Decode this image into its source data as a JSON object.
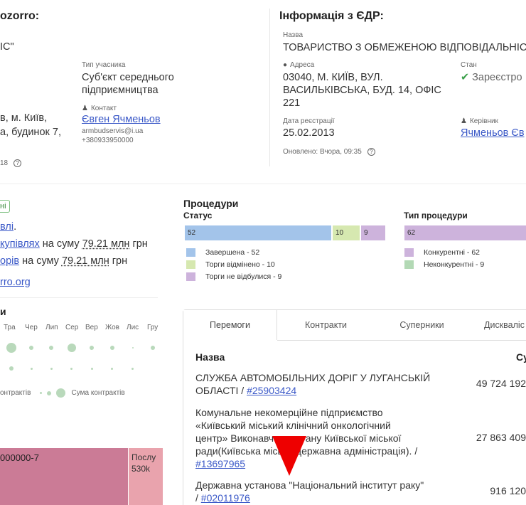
{
  "left_header": {
    "title": "ozorro:",
    "frag1": "ІС\"",
    "participant_type_label": "Тип учасника",
    "participant_type_line1": "Суб'єкт середнього",
    "participant_type_line2": "підприємництва",
    "address_frag1": "в, м. Київ,",
    "address_frag2": "а, будинок 7,",
    "contact_label": "Контакт",
    "contact_name": "Євген Ячменьов",
    "contact_email": "armbudservis@i.ua",
    "contact_phone": "+380933950000",
    "updated_frag": "18"
  },
  "edr": {
    "title": "Інформація з ЄДР:",
    "name_label": "Назва",
    "name_value": "ТОВАРИСТВО З ОБМЕЖЕНОЮ ВІДПОВІДАЛЬНІС",
    "address_label": "Адреса",
    "address_line1": "03040, М. КИЇВ, ВУЛ.",
    "address_line2": "ВАСИЛЬКІВСЬКА, БУД. 14, ОФІС",
    "address_line3": "221",
    "state_label": "Стан",
    "state_value": "Зареєстро",
    "reg_date_label": "Дата реєстрації",
    "reg_date_value": "25.02.2013",
    "head_label": "Керівник",
    "head_value": "Ячменьов Єв",
    "updated": "Оновлено: Вчора, 09:35"
  },
  "left_stats": {
    "badge_frag": "ні",
    "line1_link": "влі",
    "line1_tail": ".",
    "line2_link": "купівлях",
    "line2_mid": " на суму ",
    "line2_sum": "79.21 млн",
    "line2_tail": " грн",
    "line3_link": "орів",
    "line3_mid": " на суму ",
    "line3_sum": "79.21 млн",
    "line3_tail": " грн",
    "site_link": "rro.org"
  },
  "calendar": {
    "title": "и",
    "months": [
      "Тра",
      "Чер",
      "Лип",
      "Сер",
      "Вер",
      "Жов",
      "Лис",
      "Гру"
    ],
    "legend_left": "онтрактів",
    "legend_right": "Сума контрактів"
  },
  "treemap": {
    "main_label": "000000-7",
    "side_label": "Послу",
    "side_value": "530k"
  },
  "procedures": {
    "title": "Процедури",
    "status_title": "Статус",
    "type_title": "Тип процедури",
    "colors": {
      "done": "#a3c4ea",
      "cancelled": "#d6e8b0",
      "failed": "#cdb3dc",
      "competitive": "#cdb3dc",
      "noncompetitive": "#b3d9b5"
    },
    "status_bars": [
      {
        "name": "Завершена",
        "value": 52,
        "legend": "Завершена - 52"
      },
      {
        "name": "Торги відмінено",
        "value": 10,
        "legend": "Торги відмінено - 10"
      },
      {
        "name": "Торги не відбулися",
        "value": 9,
        "legend": "Торги не відбулися - 9"
      }
    ],
    "type_bars": [
      {
        "name": "Конкурентні",
        "value": 62,
        "legend": "Конкурентні - 62"
      },
      {
        "name": "Неконкурентні",
        "value": 9,
        "legend": "Неконкурентні - 9"
      }
    ]
  },
  "tabs": [
    "Перемоги",
    "Контракти",
    "Суперники",
    "Дискваліс"
  ],
  "table": {
    "col_name": "Назва",
    "col_sum": "Су",
    "rows": [
      {
        "name_l1": "СЛУЖБА АВТОМОБІЛЬНИХ ДОРІГ У ЛУГАНСЬКІЙ",
        "name_l2": "ОБЛАСТІ / ",
        "code": "#25903424",
        "sum": "49 724 192"
      },
      {
        "name_l1": "Комунальне некомерційне підприємство",
        "name_l2": "«Київський міський клінічний онкологічний",
        "name_l3": "центр» Виконавчого органу Київської міської",
        "name_l4": "ради(Київська міська державна адміністрація). /",
        "code": "#13697965",
        "sum": "27 863 409"
      },
      {
        "name_l1": "Державна установа \"Національний інститут раку\"",
        "name_l2": "/ ",
        "code": "#02011976",
        "sum": "916 120"
      }
    ]
  }
}
